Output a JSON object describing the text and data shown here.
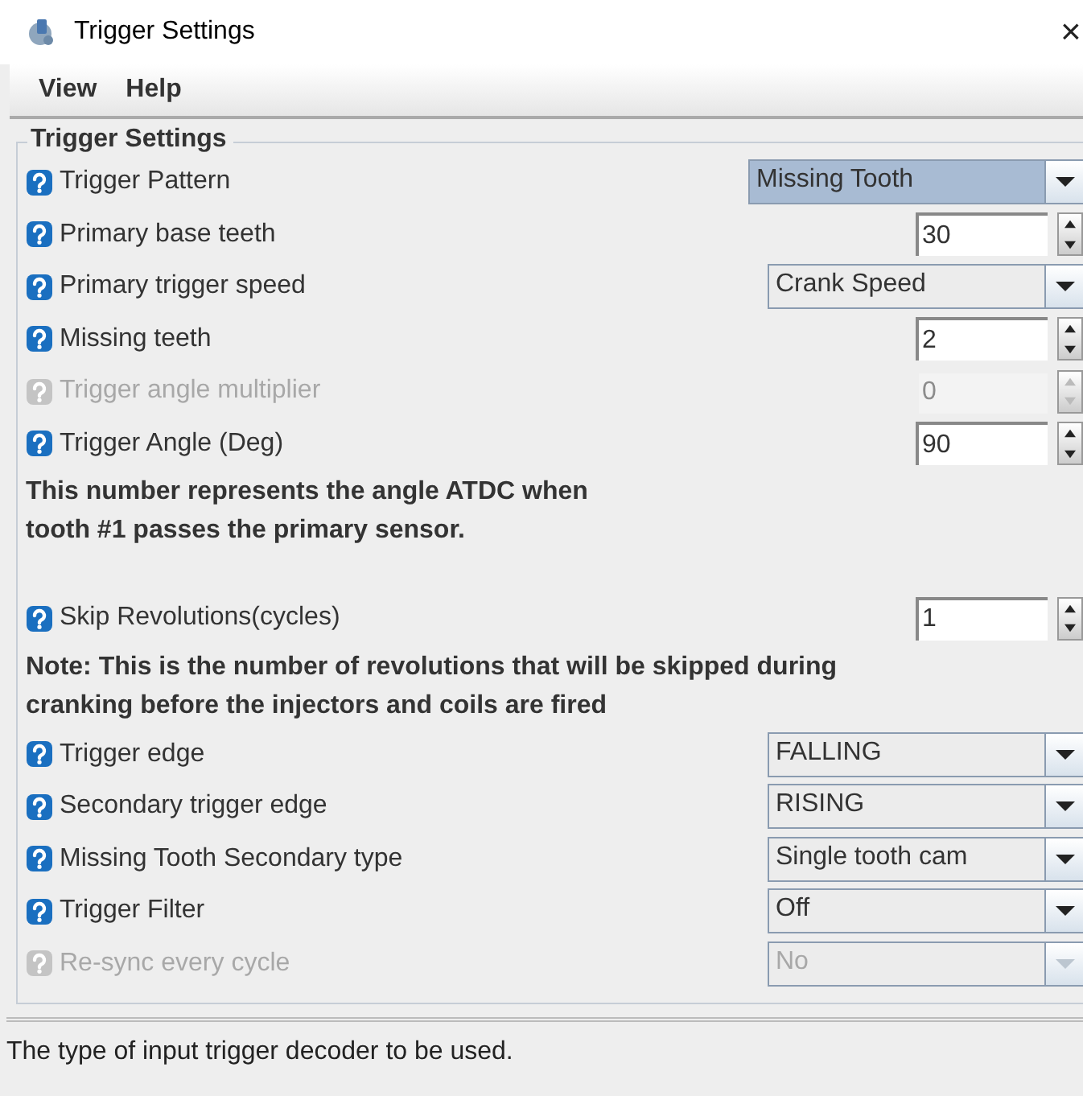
{
  "window": {
    "title": "Trigger Settings",
    "close": "×"
  },
  "menu": [
    "View",
    "Help"
  ],
  "group": {
    "title": "Trigger Settings",
    "rows": [
      {
        "kind": "combo",
        "label": "Trigger Pattern",
        "value": "Missing Tooth",
        "disabled": false,
        "focused": true
      },
      {
        "kind": "spinner",
        "label": "Primary base teeth",
        "value": "30",
        "disabled": false
      },
      {
        "kind": "combo",
        "label": "Primary trigger speed",
        "value": "Crank Speed",
        "disabled": false,
        "focused": false
      },
      {
        "kind": "spinner",
        "label": "Missing teeth",
        "value": "2",
        "disabled": false
      },
      {
        "kind": "spinner",
        "label": "Trigger angle multiplier",
        "value": "0",
        "disabled": true
      },
      {
        "kind": "spinner",
        "label": "Trigger Angle (Deg)",
        "value": "90",
        "disabled": false
      },
      {
        "kind": "note",
        "lines": [
          "This number represents the angle ATDC when",
          "tooth #1 passes the primary sensor."
        ]
      },
      {
        "kind": "spacer"
      },
      {
        "kind": "spinner",
        "label": "Skip Revolutions(cycles)",
        "value": "1",
        "disabled": false
      },
      {
        "kind": "note",
        "lines": [
          "Note: This is the number of revolutions that will be skipped during",
          "cranking before the injectors and coils are fired"
        ]
      },
      {
        "kind": "combo",
        "label": "Trigger edge",
        "value": "FALLING",
        "disabled": false,
        "focused": false
      },
      {
        "kind": "combo",
        "label": "Secondary trigger edge",
        "value": "RISING",
        "disabled": false,
        "focused": false
      },
      {
        "kind": "combo",
        "label": "Missing Tooth Secondary type",
        "value": "Single tooth cam",
        "disabled": false,
        "focused": false
      },
      {
        "kind": "combo",
        "label": "Trigger Filter",
        "value": "Off",
        "disabled": false,
        "focused": false
      },
      {
        "kind": "combo",
        "label": "Re-sync every cycle",
        "value": "No",
        "disabled": true,
        "focused": false
      }
    ]
  },
  "status_bar": "The type of input trigger decoder to be used."
}
